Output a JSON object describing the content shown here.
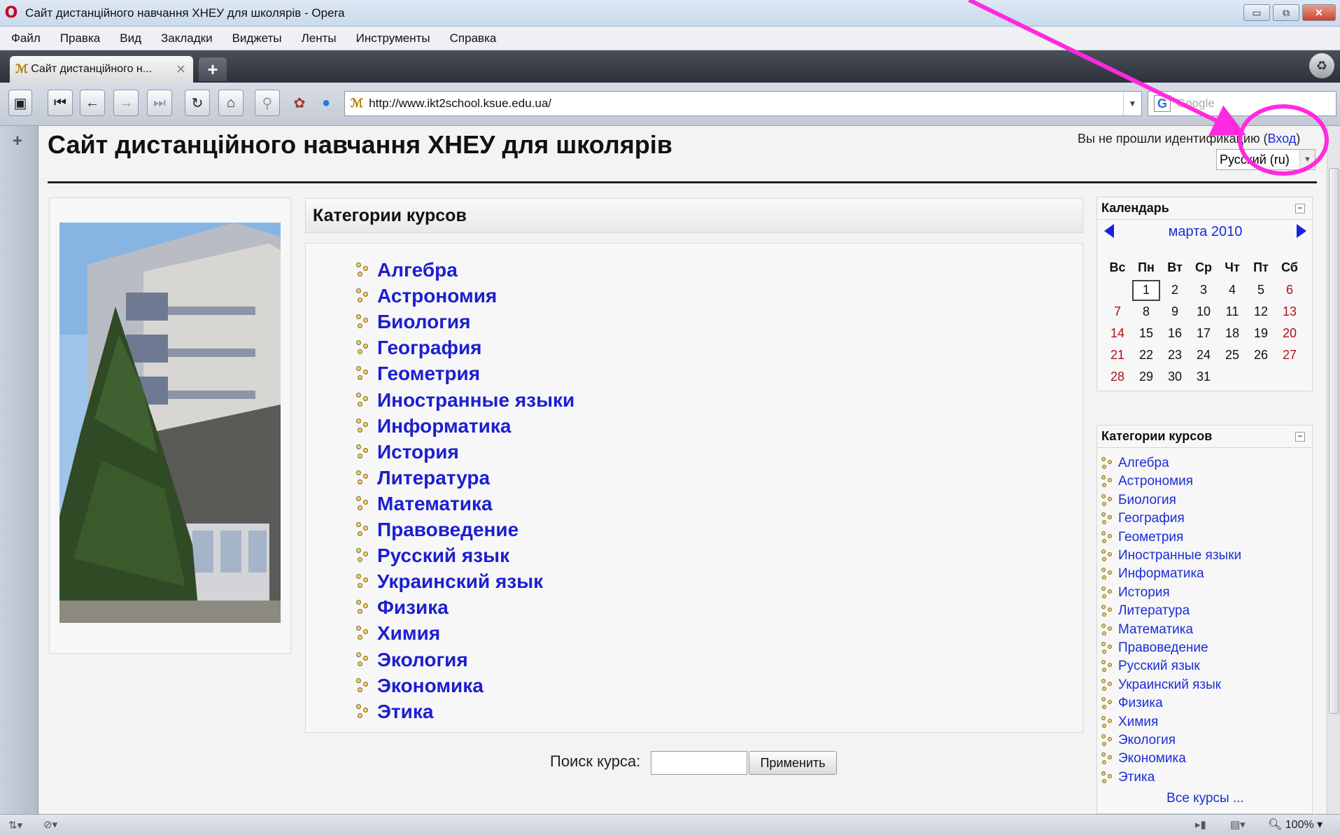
{
  "window": {
    "title": "Сайт дистанційного навчання ХНЕУ для школярів - Opera",
    "controls": {
      "minimize": "▭",
      "restore": "⧉",
      "close": "✕"
    }
  },
  "menu": [
    "Файл",
    "Правка",
    "Вид",
    "Закладки",
    "Виджеты",
    "Ленты",
    "Инструменты",
    "Справка"
  ],
  "tab": {
    "label": "Сайт дистанційного н...",
    "close": "✕",
    "new_tab": "+"
  },
  "address": {
    "url": "http://www.ikt2school.ksue.edu.ua/"
  },
  "search_engine": {
    "placeholder": "Google"
  },
  "page": {
    "site_title": "Сайт дистанційного навчання ХНЕУ для школярів",
    "login_text": "Вы не прошли идентификацию (",
    "login_link": "Вход",
    "login_close": ")",
    "language": "Русский (ru)",
    "categories_header": "Категории курсов",
    "categories": [
      "Алгебра",
      "Астрономия",
      "Биология",
      "География",
      "Геометрия",
      "Иностранные языки",
      "Информатика",
      "История",
      "Литература",
      "Математика",
      "Правоведение",
      "Русский язык",
      "Украинский язык",
      "Физика",
      "Химия",
      "Экология",
      "Экономика",
      "Этика"
    ],
    "search_label": "Поиск курса:",
    "search_value": "",
    "search_button": "Применить"
  },
  "calendar": {
    "title": "Календарь",
    "month": "марта 2010",
    "days_of_week": [
      "Вс",
      "Пн",
      "Вт",
      "Ср",
      "Чт",
      "Пт",
      "Сб"
    ],
    "weeks": [
      [
        "",
        "1",
        "2",
        "3",
        "4",
        "5",
        "6"
      ],
      [
        "7",
        "8",
        "9",
        "10",
        "11",
        "12",
        "13"
      ],
      [
        "14",
        "15",
        "16",
        "17",
        "18",
        "19",
        "20"
      ],
      [
        "21",
        "22",
        "23",
        "24",
        "25",
        "26",
        "27"
      ],
      [
        "28",
        "29",
        "30",
        "31",
        "",
        "",
        ""
      ]
    ],
    "today": "1",
    "weekend_color": "#b0101a"
  },
  "sidebar_categories": {
    "title": "Категории курсов",
    "all_courses": "Все курсы ..."
  },
  "statusbar": {
    "zoom": "100%"
  },
  "colors": {
    "link": "#1c2dd6",
    "annotation": "#ff2adf"
  }
}
